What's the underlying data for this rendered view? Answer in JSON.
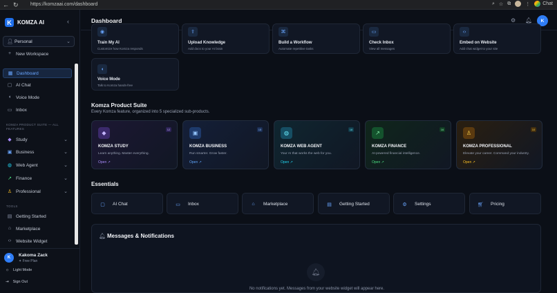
{
  "browser": {
    "url": "https://komzaai.com/dashboard",
    "profile_label": "Chat"
  },
  "sidebar": {
    "brand": "KOMZA AI",
    "workspace": "Personal",
    "new_workspace": "New Workspace",
    "main_items": [
      {
        "label": "Dashboard",
        "icon": "grid-icon"
      },
      {
        "label": "AI Chat",
        "icon": "chat-icon"
      },
      {
        "label": "Voice Mode",
        "icon": "mic-icon"
      },
      {
        "label": "Inbox",
        "icon": "inbox-icon"
      }
    ],
    "suite_heading": "KOMZA PRODUCT SUITE — ALL FEATURES",
    "suite_items": [
      {
        "label": "Study",
        "icon": "graduation-cap-icon"
      },
      {
        "label": "Business",
        "icon": "briefcase-icon"
      },
      {
        "label": "Web Agent",
        "icon": "globe-icon"
      },
      {
        "label": "Finance",
        "icon": "trending-up-icon"
      },
      {
        "label": "Professional",
        "icon": "user-icon"
      }
    ],
    "tools_heading": "TOOLS",
    "tool_items": [
      {
        "label": "Getting Started",
        "icon": "book-icon"
      },
      {
        "label": "Marketplace",
        "icon": "store-icon"
      },
      {
        "label": "Website Widget",
        "icon": "code-icon"
      }
    ],
    "user": {
      "initial": "K",
      "name": "Kakoma Zack",
      "plan": "Free Plan"
    },
    "footer": [
      {
        "label": "Light Mode",
        "icon": "sun-icon"
      },
      {
        "label": "Sign Out",
        "icon": "logout-icon"
      }
    ]
  },
  "header": {
    "title": "Dashboard",
    "avatar_initial": "K"
  },
  "quick_actions": [
    {
      "title": "Train My AI",
      "desc": "Customize how Komza responds",
      "icon": "brain-icon"
    },
    {
      "title": "Upload Knowledge",
      "desc": "Add docs to your AI brain",
      "icon": "upload-icon"
    },
    {
      "title": "Build a Workflow",
      "desc": "Automate repetitive tasks",
      "icon": "workflow-icon"
    },
    {
      "title": "Check Inbox",
      "desc": "View all messages",
      "icon": "inbox-icon"
    },
    {
      "title": "Embed on Website",
      "desc": "Add chat widget to your site",
      "icon": "code-icon"
    },
    {
      "title": "Voice Mode",
      "desc": "Talk to Komza hands-free",
      "icon": "mic-icon"
    }
  ],
  "suite": {
    "title": "Komza Product Suite",
    "subtitle": "Every Komza feature, organized into 5 specialized sub-products.",
    "cards": [
      {
        "name": "KOMZA STUDY",
        "tagline": "Learn anything. Master everything.",
        "open": "Open ↗",
        "badge": "12",
        "icon": "graduation-cap-icon",
        "accent": "#8b5cf6"
      },
      {
        "name": "KOMZA BUSINESS",
        "tagline": "Run smarter. Grow faster.",
        "open": "Open ↗",
        "badge": "15",
        "icon": "briefcase-icon",
        "accent": "#3b82f6"
      },
      {
        "name": "KOMZA WEB AGENT",
        "tagline": "Your AI that works the web for you.",
        "open": "Open ↗",
        "badge": "18",
        "icon": "globe-icon",
        "accent": "#06b6d4"
      },
      {
        "name": "KOMZA FINANCE",
        "tagline": "AI-powered financial intelligence.",
        "open": "Open ↗",
        "badge": "16",
        "icon": "trending-up-icon",
        "accent": "#22c55e"
      },
      {
        "name": "KOMZA PROFESSIONAL",
        "tagline": "Elevate your career. Command your industry.",
        "open": "Open ↗",
        "badge": "10",
        "icon": "user-icon",
        "accent": "#f59e0b"
      }
    ]
  },
  "essentials": {
    "title": "Essentials",
    "items": [
      {
        "label": "AI Chat",
        "icon": "chat-icon"
      },
      {
        "label": "Inbox",
        "icon": "inbox-icon"
      },
      {
        "label": "Marketplace",
        "icon": "store-icon"
      },
      {
        "label": "Getting Started",
        "icon": "book-icon"
      },
      {
        "label": "Settings",
        "icon": "gear-icon"
      },
      {
        "label": "Pricing",
        "icon": "cart-icon"
      }
    ]
  },
  "messages": {
    "title": "Messages & Notifications",
    "empty_text": "No notifications yet. Messages from your website widget will appear here."
  }
}
